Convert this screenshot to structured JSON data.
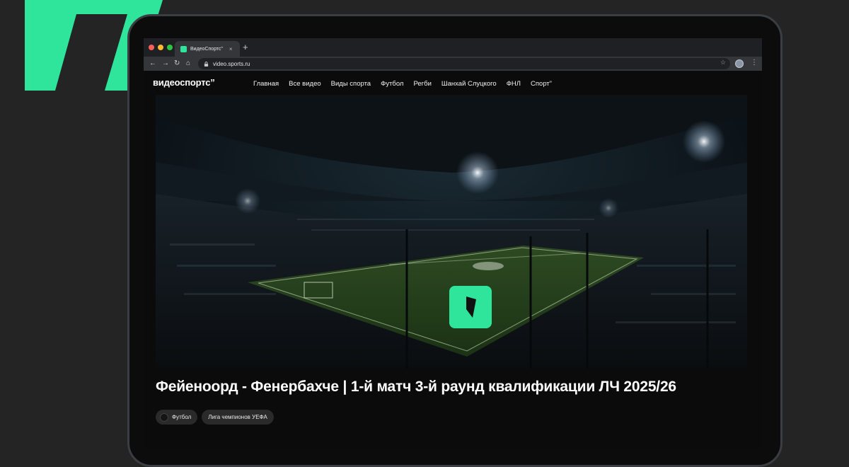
{
  "browser": {
    "tab_title": "ВидеоСпортс”",
    "tab_close": "×",
    "new_tab": "+",
    "url": "video.sports.ru",
    "back": "←",
    "forward": "→",
    "reload": "↻",
    "home": "⌂",
    "star": "☆",
    "menu": "⋮",
    "traffic_light_colors": [
      "#ff5f57",
      "#febc2e",
      "#28c840"
    ]
  },
  "site": {
    "logo": "видеоспортс”",
    "nav": [
      "Главная",
      "Все видео",
      "Виды спорта",
      "Футбол",
      "Регби",
      "Шанхай Слуцкого",
      "ФНЛ",
      "Спорт”"
    ]
  },
  "video": {
    "title": "Фейеноорд - Фенербахче | 1-й матч 3-й раунд квалификации ЛЧ 2025/26",
    "tags": [
      {
        "label": "Футбол",
        "icon": "football-icon"
      },
      {
        "label": "Лига чемпионов УЕФА",
        "icon": ""
      }
    ]
  },
  "colors": {
    "accent": "#2fe59c",
    "background": "#242424"
  }
}
